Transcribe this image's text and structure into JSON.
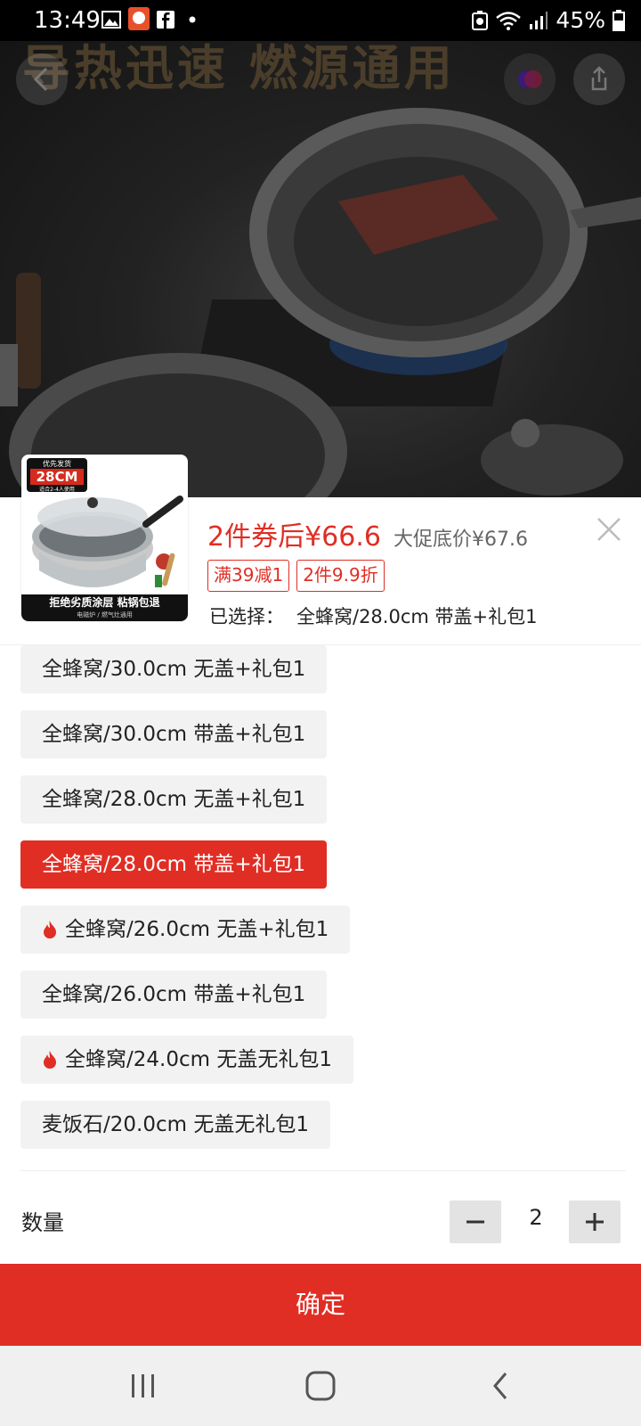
{
  "status_bar": {
    "time": "13:49",
    "battery": "45%",
    "icons": [
      "image-icon",
      "app-icon",
      "facebook-icon",
      "dot-icon",
      "recycle-icon",
      "wifi-icon",
      "signal-icon",
      "battery-icon"
    ]
  },
  "hero": {
    "banner_text": "导热迅速 燃源通用"
  },
  "product": {
    "thumb_tag_top": "优先发货",
    "thumb_size": "28CM",
    "thumb_tag_sub": "适合2-4人使用",
    "thumb_footer_main": "拒绝劣质涂层 粘锅包退",
    "thumb_footer_sub": "电磁炉 / 燃气灶通用",
    "price_label": "2件券后¥66.6",
    "promo_price": "大促底价¥67.6",
    "coupons": [
      "满39减1",
      "2件9.9折"
    ],
    "selected_label": "已选择：",
    "selected_value": "全蜂窝/28.0cm 带盖+礼包1"
  },
  "options": [
    {
      "label": "全蜂窝/30.0cm 无盖+礼包1",
      "hot": false,
      "selected": false
    },
    {
      "label": "全蜂窝/30.0cm 带盖+礼包1",
      "hot": false,
      "selected": false
    },
    {
      "label": "全蜂窝/28.0cm 无盖+礼包1",
      "hot": false,
      "selected": false
    },
    {
      "label": "全蜂窝/28.0cm 带盖+礼包1",
      "hot": false,
      "selected": true
    },
    {
      "label": "全蜂窝/26.0cm 无盖+礼包1",
      "hot": true,
      "selected": false
    },
    {
      "label": "全蜂窝/26.0cm 带盖+礼包1",
      "hot": false,
      "selected": false
    },
    {
      "label": "全蜂窝/24.0cm 无盖无礼包1",
      "hot": true,
      "selected": false
    },
    {
      "label": "麦饭石/20.0cm 无盖无礼包1",
      "hot": false,
      "selected": false
    }
  ],
  "quantity": {
    "label": "数量",
    "value": "2"
  },
  "confirm_label": "确定",
  "colors": {
    "accent": "#e02e24",
    "chip_bg": "#f2f2f2"
  }
}
